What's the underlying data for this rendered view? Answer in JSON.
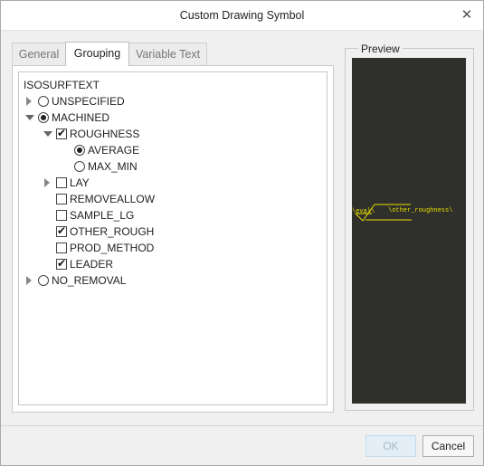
{
  "window": {
    "title": "Custom Drawing Symbol",
    "close_glyph": "✕"
  },
  "tabs": [
    {
      "label": "General",
      "active": false
    },
    {
      "label": "Grouping",
      "active": true
    },
    {
      "label": "Variable Text",
      "active": false
    }
  ],
  "tree": {
    "root": "ISOSURFTEXT",
    "nodes": [
      {
        "id": "unspecified",
        "label": "UNSPECIFIED",
        "control": "radio",
        "checked": false,
        "expander": "collapsed",
        "level": 0
      },
      {
        "id": "machined",
        "label": "MACHINED",
        "control": "radio",
        "checked": true,
        "expander": "expanded",
        "level": 0
      },
      {
        "id": "roughness",
        "label": "ROUGHNESS",
        "control": "checkbox",
        "checked": true,
        "expander": "expanded",
        "level": 1
      },
      {
        "id": "average",
        "label": "AVERAGE",
        "control": "radio",
        "checked": true,
        "expander": "none",
        "level": 2
      },
      {
        "id": "max-min",
        "label": "MAX_MIN",
        "control": "radio",
        "checked": false,
        "expander": "none",
        "level": 2
      },
      {
        "id": "lay",
        "label": "LAY",
        "control": "checkbox",
        "checked": false,
        "expander": "collapsed",
        "level": 1
      },
      {
        "id": "removeallow",
        "label": "REMOVEALLOW",
        "control": "checkbox",
        "checked": false,
        "expander": "none",
        "level": 1
      },
      {
        "id": "sample-lg",
        "label": "SAMPLE_LG",
        "control": "checkbox",
        "checked": false,
        "expander": "none",
        "level": 1
      },
      {
        "id": "other-rough",
        "label": "OTHER_ROUGH",
        "control": "checkbox",
        "checked": true,
        "expander": "none",
        "level": 1
      },
      {
        "id": "prod-method",
        "label": "PROD_METHOD",
        "control": "checkbox",
        "checked": false,
        "expander": "none",
        "level": 1
      },
      {
        "id": "leader",
        "label": "LEADER",
        "control": "checkbox",
        "checked": true,
        "expander": "none",
        "level": 1
      },
      {
        "id": "no-removal",
        "label": "NO_REMOVAL",
        "control": "radio",
        "checked": false,
        "expander": "collapsed",
        "level": 0
      }
    ]
  },
  "preview": {
    "label": "Preview",
    "symbol_left_text": "\\eval\\",
    "symbol_right_text": "\\other_roughness\\",
    "symbol_color": "#e8e000",
    "background_color": "#2f2f2b"
  },
  "buttons": {
    "ok": "OK",
    "cancel": "Cancel",
    "ok_enabled": false
  }
}
